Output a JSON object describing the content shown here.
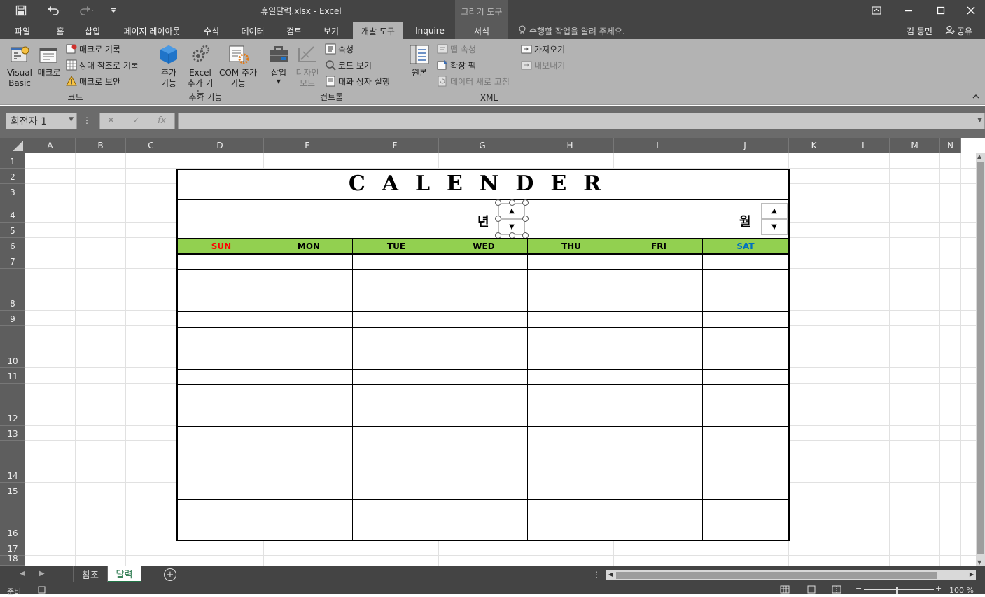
{
  "titlebar": {
    "title": "휴일달력.xlsx - Excel",
    "context_group": "그리기 도구"
  },
  "menu": {
    "tabs": [
      "파일",
      "홈",
      "삽입",
      "페이지 레이아웃",
      "수식",
      "데이터",
      "검토",
      "보기",
      "개발 도구",
      "Inquire",
      "서식"
    ],
    "active_tab": "개발 도구",
    "tell_me": "수행할 작업을 알려 주세요.",
    "user": "김 동민",
    "share": "공유"
  },
  "ribbon": {
    "code": {
      "label": "코드",
      "visual_basic": "Visual Basic",
      "macro": "매크로",
      "record_macro": "매크로 기록",
      "relative_ref": "상대 참조로 기록",
      "macro_security": "매크로 보안"
    },
    "addins": {
      "label": "추가 기능",
      "addins": "추가 기능",
      "excel_addins": "Excel 추가 기능",
      "com_addins": "COM 추가 기능"
    },
    "controls": {
      "label": "컨트롤",
      "insert": "삽입",
      "design_mode": "디자인 모드",
      "properties": "속성",
      "view_code": "코드 보기",
      "run_dialog": "대화 상자 실행"
    },
    "xml": {
      "label": "XML",
      "source": "원본",
      "map_props": "맵 속성",
      "expansion": "확장 팩",
      "refresh": "데이터 새로 고침",
      "import": "가져오기",
      "export": "내보내기"
    }
  },
  "formula_bar": {
    "name_box": "회전자 1",
    "fx": "fx"
  },
  "grid": {
    "columns": [
      "A",
      "B",
      "C",
      "D",
      "E",
      "F",
      "G",
      "H",
      "I",
      "J",
      "K",
      "L",
      "M",
      "N"
    ],
    "rows": [
      "1",
      "2",
      "3",
      "4",
      "5",
      "6",
      "7",
      "8",
      "9",
      "10",
      "11",
      "12",
      "13",
      "14",
      "15",
      "16",
      "17",
      "18"
    ]
  },
  "calendar": {
    "title": "CALENDER",
    "year_label": "년",
    "month_label": "월",
    "days": [
      "SUN",
      "MON",
      "TUE",
      "WED",
      "THU",
      "FRI",
      "SAT"
    ],
    "sun_color": "#ff0000",
    "sat_color": "#0070c0",
    "header_color": "#92d050"
  },
  "sheets": {
    "tabs": [
      "참조",
      "달력"
    ],
    "active": "달력"
  },
  "status": {
    "ready": "준비",
    "zoom": "100 %"
  }
}
